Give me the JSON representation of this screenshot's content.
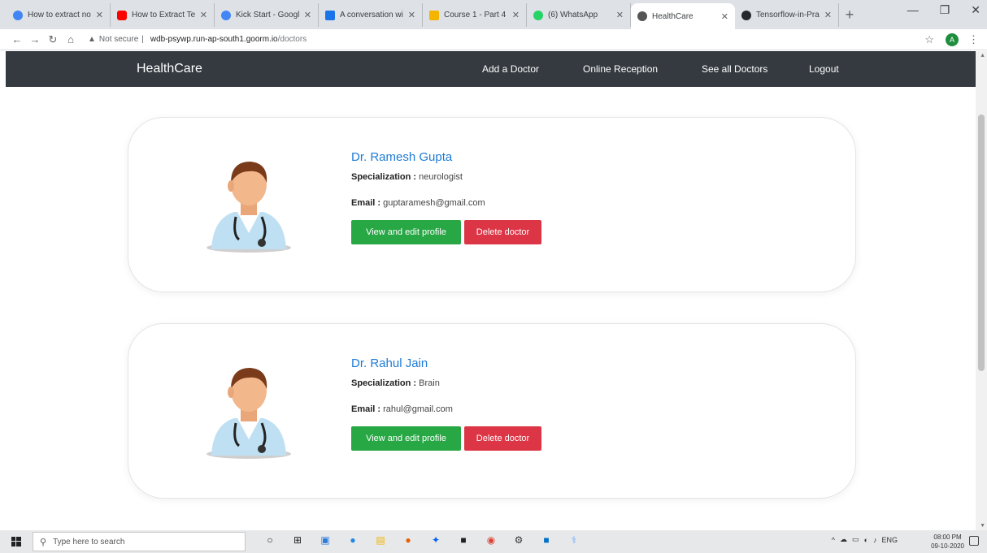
{
  "browser": {
    "tabs": [
      {
        "title": "How to extract no",
        "fav_color": "#4285f4"
      },
      {
        "title": "How to Extract Te",
        "fav_color": "#ff0000"
      },
      {
        "title": "Kick Start - Googl",
        "fav_color": "#4285f4"
      },
      {
        "title": "A conversation wi",
        "fav_color": "#1a73e8"
      },
      {
        "title": "Course 1 - Part 4",
        "fav_color": "#f4b400"
      },
      {
        "title": "(6) WhatsApp",
        "fav_color": "#25d366"
      },
      {
        "title": "HealthCare",
        "fav_color": "#555555",
        "active": true
      },
      {
        "title": "Tensorflow-in-Pra",
        "fav_color": "#24292e"
      }
    ],
    "address": {
      "security": "Not secure",
      "host": "wdb-psywp.run-ap-south1.goorm.io",
      "path": "/doctors"
    },
    "profile_initial": "A"
  },
  "navbar": {
    "brand": "HealthCare",
    "links": [
      "Add a Doctor",
      "Online Reception",
      "See all Doctors",
      "Logout"
    ]
  },
  "doctors": [
    {
      "name": "Dr. Ramesh Gupta",
      "specialization_label": "Specialization :",
      "specialization": "neurologist",
      "email_label": "Email :",
      "email": "guptaramesh@gmail.com",
      "edit_label": "View and edit profile",
      "delete_label": "Delete doctor"
    },
    {
      "name": "Dr. Rahul Jain",
      "specialization_label": "Specialization :",
      "specialization": "Brain",
      "email_label": "Email :",
      "email": "rahul@gmail.com",
      "edit_label": "View and edit profile",
      "delete_label": "Delete doctor"
    }
  ],
  "taskbar": {
    "search_placeholder": "Type here to search",
    "tray_lang": "ENG",
    "time": "08:00 PM",
    "date": "09-10-2020"
  },
  "colors": {
    "navbar_bg": "#343a40",
    "link_blue": "#1e7bd6",
    "btn_green": "#28a745",
    "btn_red": "#dc3545"
  }
}
